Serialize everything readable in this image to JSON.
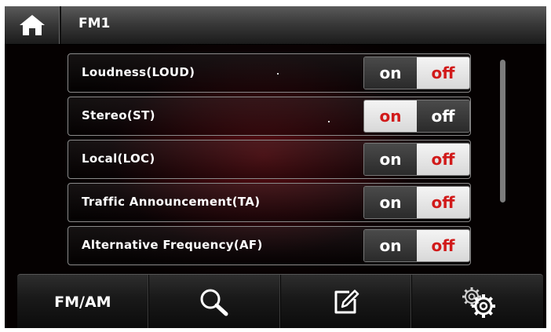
{
  "header": {
    "title": "FM1",
    "home_icon": "home-icon"
  },
  "settings": [
    {
      "label": "Loudness(LOUD)",
      "on_label": "on",
      "off_label": "off",
      "state": "off"
    },
    {
      "label": "Stereo(ST)",
      "on_label": "on",
      "off_label": "off",
      "state": "on"
    },
    {
      "label": "Local(LOC)",
      "on_label": "on",
      "off_label": "off",
      "state": "off"
    },
    {
      "label": "Traffic Announcement(TA)",
      "on_label": "on",
      "off_label": "off",
      "state": "off"
    },
    {
      "label": "Alternative Frequency(AF)",
      "on_label": "on",
      "off_label": "off",
      "state": "off"
    }
  ],
  "bottom_bar": {
    "band_label": "FM/AM",
    "search_icon": "search-icon",
    "edit_icon": "edit-icon",
    "settings_icon": "gears-icon"
  },
  "colors": {
    "active_text": "#d11a1a",
    "active_bg": "#f0f0f0",
    "inactive_bg": "#3a3a3a"
  }
}
